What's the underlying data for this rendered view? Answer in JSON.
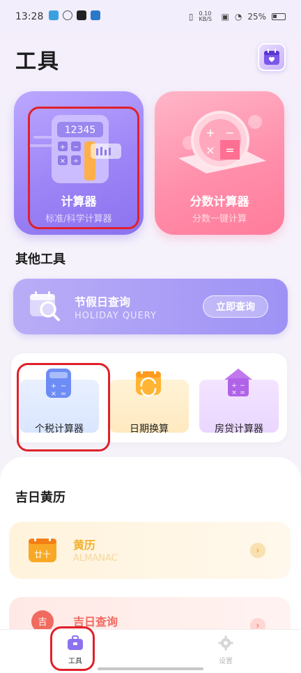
{
  "status_bar": {
    "time": "13:28",
    "network": "0.10 KB/S",
    "battery": "25%"
  },
  "header": {
    "title": "工具"
  },
  "cards": {
    "calculator": {
      "title": "计算器",
      "subtitle": "标准/科学计算器",
      "display": "12345"
    },
    "fraction": {
      "title": "分数计算器",
      "subtitle": "分数一键计算"
    }
  },
  "other_tools": {
    "section_title": "其他工具",
    "holiday": {
      "title": "节假日查询",
      "subtitle": "HOLIDAY QUERY",
      "button": "立即查询"
    },
    "tools": [
      {
        "label": "个税计算器"
      },
      {
        "label": "日期换算"
      },
      {
        "label": "房贷计算器"
      }
    ]
  },
  "almanac": {
    "section_title": "吉日黄历",
    "items": [
      {
        "title": "黄历",
        "subtitle": "ALMANAC",
        "icon_text": "廿十"
      },
      {
        "title": "吉日查询",
        "icon_text": "吉"
      }
    ]
  },
  "bottom_nav": {
    "tools_label": "工具",
    "settings_label": "设置"
  },
  "colors": {
    "accent": "#8c72ee",
    "pink": "#ff7b9b",
    "highlight": "#e0202a"
  }
}
